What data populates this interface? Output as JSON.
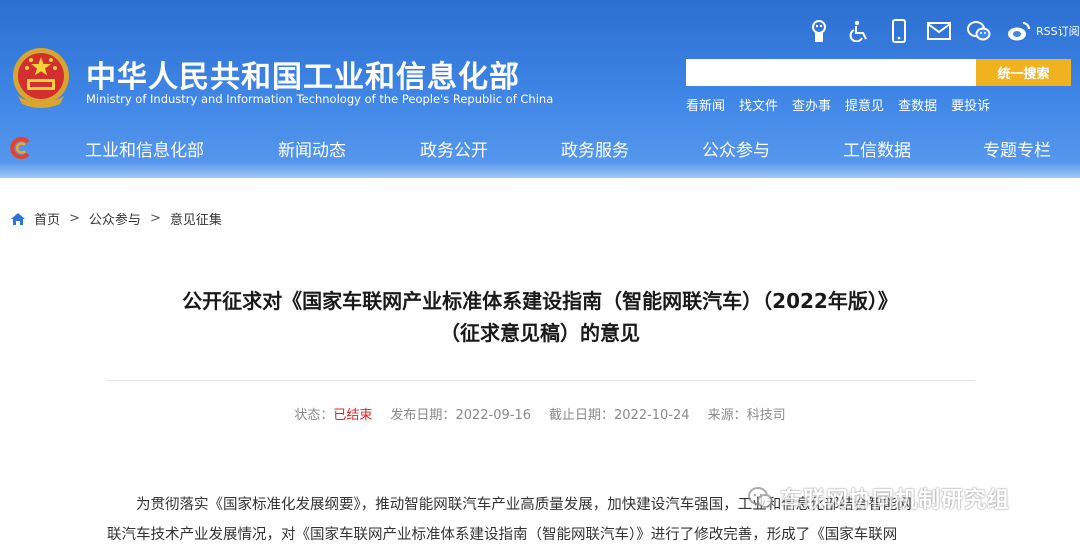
{
  "header": {
    "title_cn": "中华人民共和国工业和信息化部",
    "title_en": "Ministry of Industry and Information Technology of the People's Republic of China",
    "rss_label": "RSS订阅",
    "search_placeholder": "",
    "search_button": "统一搜索",
    "quick_links": [
      "看新闻",
      "找文件",
      "查办事",
      "提意见",
      "查数据",
      "要投诉"
    ],
    "utility_icons": [
      "mascot-icon",
      "accessibility-icon",
      "mobile-icon",
      "mail-icon",
      "wechat-icon",
      "weibo-icon"
    ]
  },
  "nav": {
    "items": [
      "工业和信息化部",
      "新闻动态",
      "政务公开",
      "政务服务",
      "公众参与",
      "工信数据",
      "专题专栏"
    ]
  },
  "breadcrumb": {
    "home": "首页",
    "sep": ">",
    "level1": "公众参与",
    "level2": "意见征集"
  },
  "article": {
    "title_line1": "公开征求对《国家车联网产业标准体系建设指南（智能网联汽车）（2022年版）》",
    "title_line2": "（征求意见稿）的意见",
    "meta": {
      "status_label": "状态：",
      "status_value": "已结束",
      "publish_label": "发布日期：",
      "publish_date": "2022-09-16",
      "deadline_label": "截止日期：",
      "deadline_date": "2022-10-24",
      "source_label": "来源：",
      "source_value": "科技司"
    },
    "body_line1": "为贯彻落实《国家标准化发展纲要》，推动智能网联汽车产业高质量发展，加快建设汽车强国，工业和信息化部结合智能网",
    "body_line2": "联汽车技术产业发展情况，对《国家车联网产业标准体系建设指南（智能网联汽车）》进行了修改完善，形成了《国家车联网"
  },
  "watermark": {
    "text": "车联网协同机制研究组"
  },
  "colors": {
    "header_blue": "#3f86e6",
    "search_button": "#f1b21f",
    "status_red": "#e02020"
  }
}
